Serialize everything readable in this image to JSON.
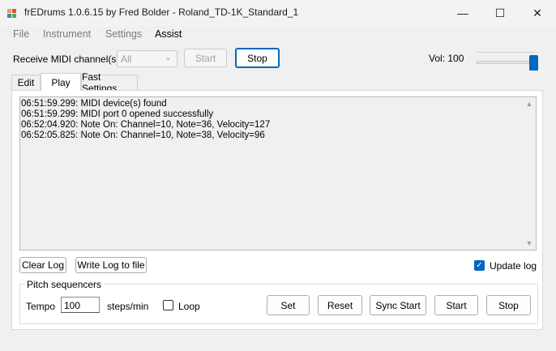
{
  "window": {
    "title": "frEDrums 1.0.6.15 by Fred Bolder - Roland_TD-1K_Standard_1",
    "minimize": "—",
    "maximize": "☐",
    "close": "✕"
  },
  "menu": [
    "File",
    "Instrument",
    "Settings",
    "Assist"
  ],
  "toolbar": {
    "receive_label": "Receive MIDI channel(s)",
    "channel_value": "All",
    "start_label": "Start",
    "stop_label": "Stop",
    "vol_label": "Vol: 100",
    "volume": 100
  },
  "tabs": [
    "Edit",
    "Play",
    "Fast Settings"
  ],
  "active_tab": "Play",
  "log": [
    "06:51:59.299: MIDI device(s) found",
    "06:51:59.299: MIDI port 0 opened successfully",
    "06:52:04.920: Note On: Channel=10, Note=36, Velocity=127",
    "06:52:05.825: Note On: Channel=10, Note=38, Velocity=96"
  ],
  "log_buttons": {
    "clear": "Clear Log",
    "write": "Write Log to file",
    "update_label": "Update log",
    "update_checked": true
  },
  "pitch": {
    "group_title": "Pitch sequencers",
    "tempo_label": "Tempo",
    "tempo_value": "100",
    "steps_label": "steps/min",
    "loop_label": "Loop",
    "loop_checked": false,
    "set": "Set",
    "reset": "Reset",
    "sync_start": "Sync Start",
    "start": "Start",
    "stop": "Stop"
  },
  "colors": {
    "accent": "#0067c0",
    "background": "#f0f0f0",
    "disabled_text": "#a0a0a0"
  }
}
